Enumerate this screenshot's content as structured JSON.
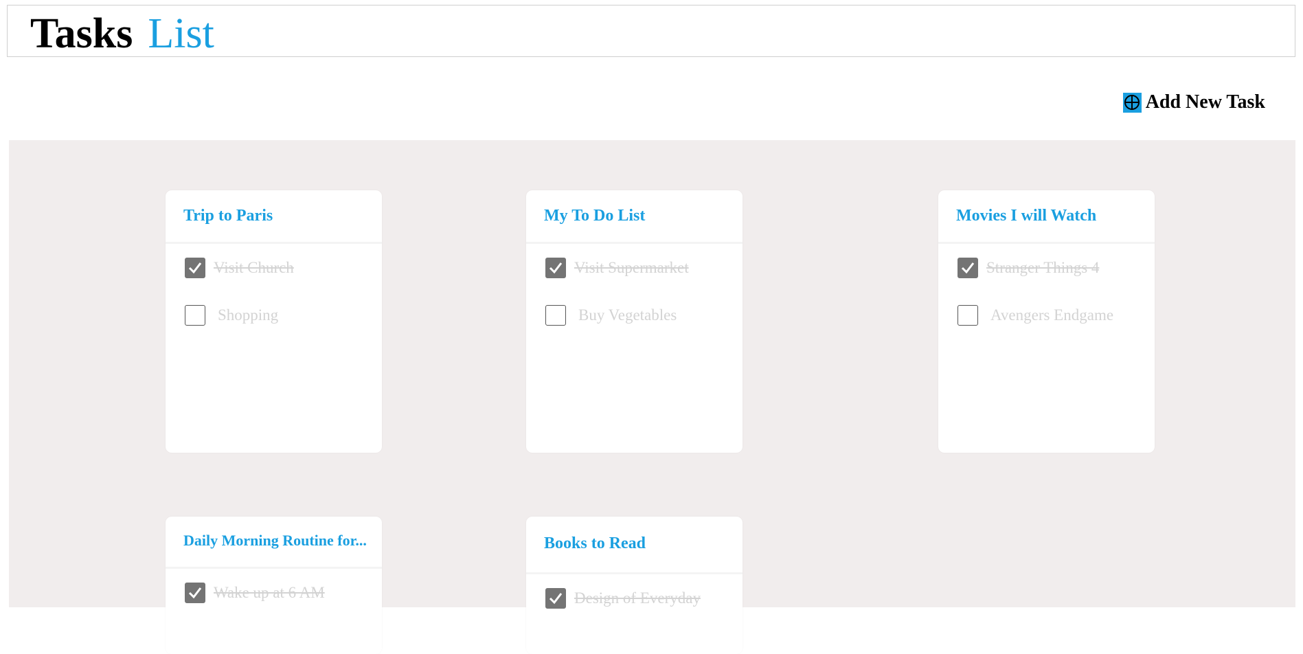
{
  "header": {
    "title_part1": "Tasks",
    "title_part2": "List"
  },
  "toolbar": {
    "add_task_label": "Add New Task",
    "add_icon": "circle-plus-icon",
    "accent_color": "#1a9fe0"
  },
  "board": {
    "background": "#f1eded",
    "cards": [
      {
        "title": "Trip to Paris",
        "tasks": [
          {
            "label": "Visit Church",
            "done": true
          },
          {
            "label": "Shopping",
            "done": false
          }
        ]
      },
      {
        "title": "My To Do List",
        "tasks": [
          {
            "label": "Visit Supermarket",
            "done": true
          },
          {
            "label": "Buy Vegetables",
            "done": false
          }
        ]
      },
      {
        "title": "Movies I will Watch",
        "tasks": [
          {
            "label": "Stranger Things 4",
            "done": true
          },
          {
            "label": "Avengers Endgame",
            "done": false
          }
        ]
      },
      {
        "title": "Daily Morning Routine for...",
        "tasks": [
          {
            "label": "Wake up at 6 AM",
            "done": true
          }
        ]
      },
      {
        "title": "Books to Read",
        "tasks": [
          {
            "label": "Design of Everyday",
            "done": true
          }
        ]
      }
    ]
  }
}
